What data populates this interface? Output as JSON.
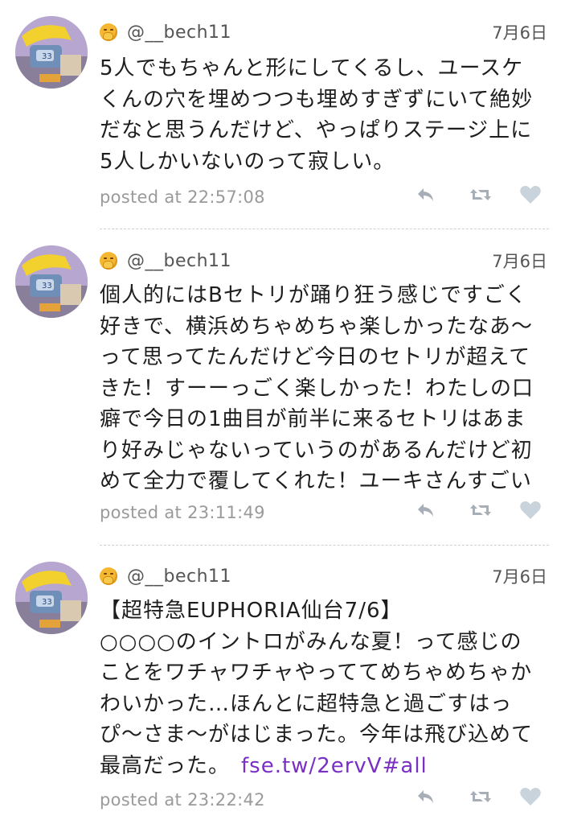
{
  "posts": [
    {
      "handle": "@__bech11",
      "date": "7月6日",
      "lines": [
        "5人でもちゃんと形にしてくるし、ユースケ",
        "くんの穴を埋めつつも埋めすぎずにいて絶妙",
        "だなと思うんだけど、やっぱりステージ上に",
        "5人しかいないのって寂しい。"
      ],
      "link": "",
      "posted_label": "posted at",
      "time": "22:57:08"
    },
    {
      "handle": "@__bech11",
      "date": "7月6日",
      "lines": [
        "個人的にはBセトリが踊り狂う感じですごく",
        "好きで、横浜めちゃめちゃ楽しかったなあ〜",
        "って思ってたんだけど今日のセトリが超えて",
        "きた！すーーっごく楽しかった！わたしの口",
        "癖で今日の1曲目が前半に来るセトリはあま",
        "り好みじゃないっていうのがあるんだけど初",
        "めて全力で覆してくれた！ユーキさんすごい"
      ],
      "link": "",
      "posted_label": "posted at",
      "time": "23:11:49"
    },
    {
      "handle": "@__bech11",
      "date": "7月6日",
      "lines": [
        "【超特急EUPHORIA仙台7/6】",
        "○○○○のイントロがみんな夏！って感じの",
        "ことをワチャワチャやっててめちゃめちゃか",
        "わいかった…ほんとに超特急と過ごすはっ",
        "ぴ〜さま〜がはじまった。今年は飛び込めて",
        "最高だった。"
      ],
      "link": "fse.tw/2ervV#all",
      "posted_label": "posted at",
      "time": "23:22:42"
    }
  ],
  "icons": {
    "avatar": "user-avatar",
    "emoji": "hand-over-mouth-emoji-icon",
    "reply": "reply-icon",
    "retweet": "retweet-icon",
    "like": "heart-icon"
  },
  "colors": {
    "link": "#7a2fc4",
    "meta": "#9a9a9a",
    "action_icon": "#a7aeb6",
    "like_icon": "#c9d3dc"
  }
}
